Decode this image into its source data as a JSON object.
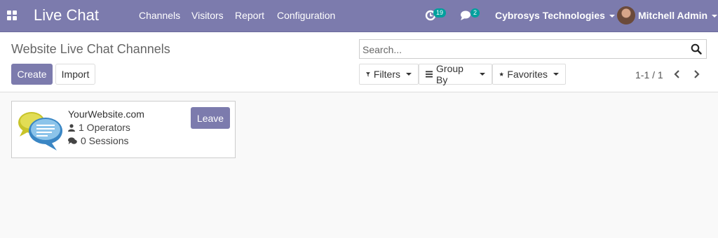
{
  "navbar": {
    "brand": "Live Chat",
    "menu": [
      "Channels",
      "Visitors",
      "Report",
      "Configuration"
    ],
    "activity_count": "19",
    "messages_count": "2",
    "company": "Cybrosys Technologies",
    "user": "Mitchell Admin",
    "accent_color": "#7c7bad",
    "badge_color": "#00a09d"
  },
  "control_panel": {
    "title": "Website Live Chat Channels",
    "create_label": "Create",
    "import_label": "Import",
    "search_placeholder": "Search...",
    "filters_label": "Filters",
    "group_by_label": "Group By",
    "favorites_label": "Favorites",
    "pager": "1-1 / 1"
  },
  "cards": [
    {
      "title": "YourWebsite.com",
      "operators": "1 Operators",
      "sessions": "0 Sessions",
      "action_label": "Leave",
      "image_icon": "chat-bubbles-icon"
    }
  ]
}
